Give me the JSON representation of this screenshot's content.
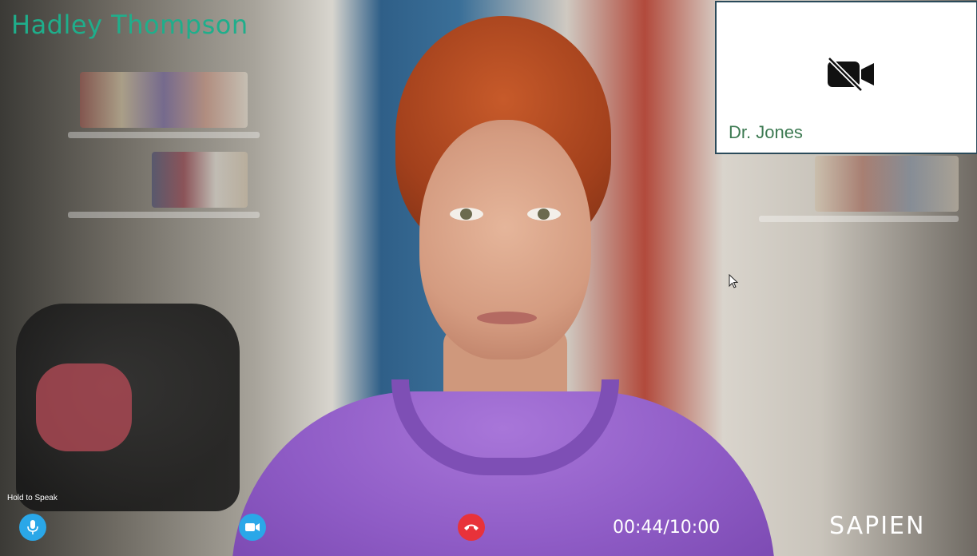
{
  "call": {
    "remote_name": "Hadley Thompson",
    "self_name": "Dr. Jones",
    "timer": "00:44/10:00"
  },
  "controls": {
    "hold_to_speak_label": "Hold to Speak",
    "mic_icon": "microphone-icon",
    "camera_icon": "video-camera-icon",
    "end_call_icon": "phone-hangup-icon"
  },
  "self_view": {
    "camera_status_icon": "video-off-icon"
  },
  "brand": {
    "logo_text": "SAPIEN"
  },
  "colors": {
    "accent_blue": "#2aa7e8",
    "end_call_red": "#e8323a",
    "remote_name_green": "#1fae8b",
    "self_name_green": "#3d7a52"
  }
}
